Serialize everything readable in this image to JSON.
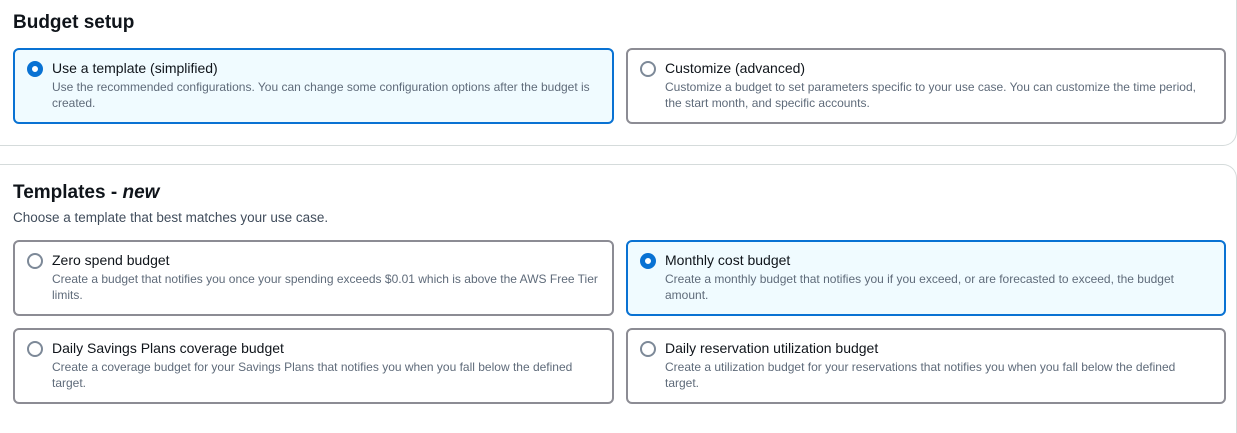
{
  "budget_setup": {
    "title": "Budget setup",
    "options": [
      {
        "label": "Use a template (simplified)",
        "description": "Use the recommended configurations. You can change some configuration options after the budget is created.",
        "selected": true
      },
      {
        "label": "Customize (advanced)",
        "description": "Customize a budget to set parameters specific to your use case. You can customize the time period, the start month, and specific accounts.",
        "selected": false
      }
    ]
  },
  "templates": {
    "title": "Templates - ",
    "title_badge": "new",
    "description": "Choose a template that best matches your use case.",
    "options": [
      {
        "label": "Zero spend budget",
        "description": "Create a budget that notifies you once your spending exceeds $0.01 which is above the AWS Free Tier limits.",
        "selected": false
      },
      {
        "label": "Monthly cost budget",
        "description": "Create a monthly budget that notifies you if you exceed, or are forecasted to exceed, the budget amount.",
        "selected": true
      },
      {
        "label": "Daily Savings Plans coverage budget",
        "description": "Create a coverage budget for your Savings Plans that notifies you when you fall below the defined target.",
        "selected": false
      },
      {
        "label": "Daily reservation utilization budget",
        "description": "Create a utilization budget for your reservations that notifies you when you fall below the defined target.",
        "selected": false
      }
    ]
  },
  "colors": {
    "accent": "#0972d3",
    "selected_background": "#f0fbff",
    "border": "#8c8c94"
  }
}
